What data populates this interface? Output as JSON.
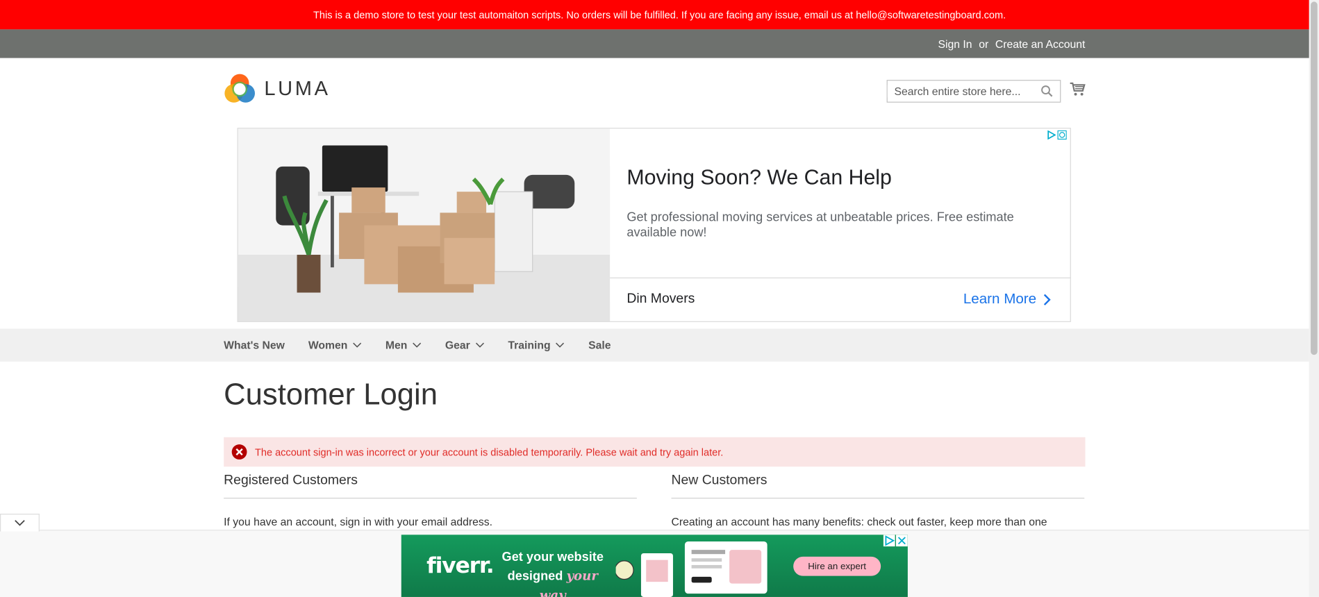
{
  "demo_notice": "This is a demo store to test your test automaiton scripts. No orders will be fulfilled. If you are facing any issue, email us at hello@softwaretestingboard.com.",
  "header_links": {
    "sign_in": "Sign In",
    "or": "or",
    "create_account": "Create an Account"
  },
  "logo": {
    "text": "LUMA"
  },
  "search": {
    "placeholder": "Search entire store here..."
  },
  "ad": {
    "title": "Moving Soon? We Can Help",
    "description": "Get professional moving services at unbeatable prices. Free estimate available now!",
    "advertiser": "Din Movers",
    "cta": "Learn More"
  },
  "nav": {
    "items": [
      {
        "label": "What's New",
        "has_dropdown": false
      },
      {
        "label": "Women",
        "has_dropdown": true
      },
      {
        "label": "Men",
        "has_dropdown": true
      },
      {
        "label": "Gear",
        "has_dropdown": true
      },
      {
        "label": "Training",
        "has_dropdown": true
      },
      {
        "label": "Sale",
        "has_dropdown": false
      }
    ]
  },
  "page_title": "Customer Login",
  "error_message": "The account sign-in was incorrect or your account is disabled temporarily. Please wait and try again later.",
  "registered": {
    "title": "Registered Customers",
    "text": "If you have an account, sign in with your email address."
  },
  "new_customers": {
    "title": "New Customers",
    "text": "Creating an account has many benefits: check out faster, keep more than one address, track orders and more."
  },
  "bottom_ad": {
    "brand": "fiverr.",
    "headline_1": "Get your website",
    "headline_2a": "designed",
    "headline_2b": "your way",
    "cta": "Hire an expert"
  },
  "colors": {
    "demo_bar": "#ff0000",
    "top_bar": "#6e716e",
    "nav_bg": "#f0f0f0",
    "error_bg": "#fae5e5",
    "error_text": "#e02b27",
    "link_blue": "#1a73e8"
  }
}
